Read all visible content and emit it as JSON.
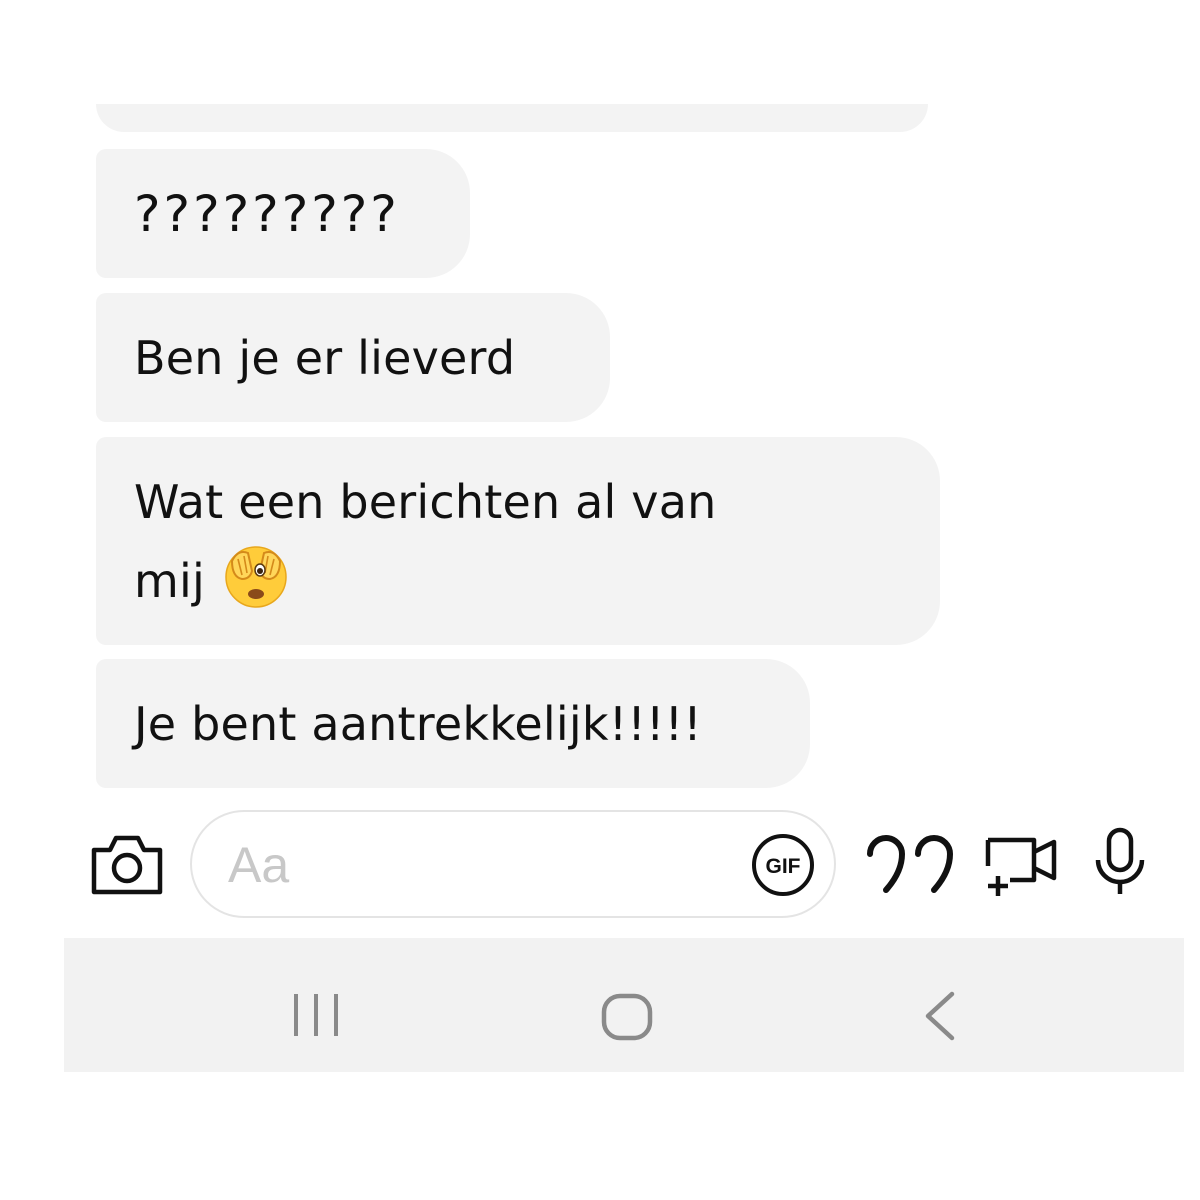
{
  "messages": [
    {
      "text": "?????????"
    },
    {
      "text": "Ben je er lieverd"
    },
    {
      "line1": "Wat een berichten al van",
      "line2": "mij",
      "emoji": "face-with-peeking-eye"
    },
    {
      "text": "Je bent aantrekkelijk!!!!!"
    }
  ],
  "composer": {
    "placeholder": "Aa",
    "gif_label": "GIF",
    "icons": [
      "camera-icon",
      "gif-icon",
      "quote-icon",
      "video-add-icon",
      "microphone-icon"
    ]
  },
  "system_nav": {
    "icons": [
      "recent-apps-icon",
      "home-icon",
      "back-icon"
    ]
  },
  "colors": {
    "bubble": "#f3f3f3",
    "text": "#111111",
    "nav_bg": "#f2f2f2",
    "nav_icon": "#8a8a8a",
    "emoji_yellow": "#ffcc3a"
  }
}
